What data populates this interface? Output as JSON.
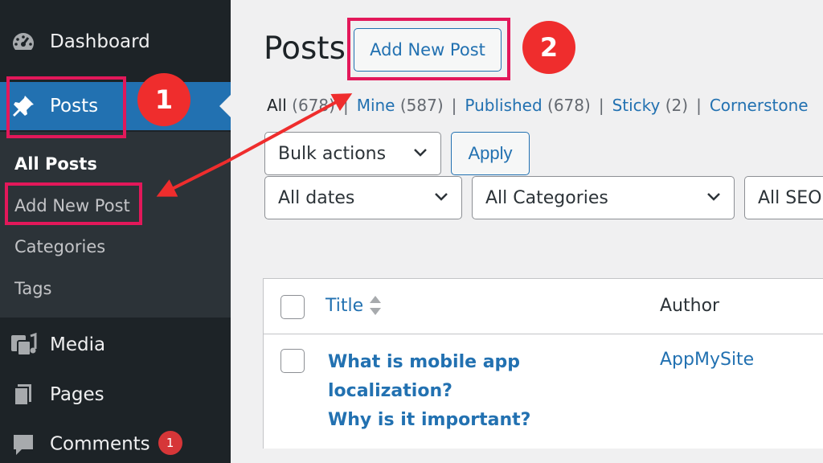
{
  "sidebar": {
    "items": [
      {
        "label": "Dashboard",
        "icon": "dashboard-icon"
      },
      {
        "label": "Posts",
        "icon": "pushpin-icon"
      },
      {
        "label": "Media",
        "icon": "media-icon"
      },
      {
        "label": "Pages",
        "icon": "pages-icon"
      },
      {
        "label": "Comments",
        "icon": "comment-icon",
        "badge": "1"
      }
    ],
    "submenu": [
      "All Posts",
      "Add New Post",
      "Categories",
      "Tags"
    ]
  },
  "main": {
    "title": "Posts",
    "add_new_label": "Add New Post",
    "filters": [
      {
        "label": "All",
        "count": "(678)"
      },
      {
        "label": "Mine",
        "count": "(587)"
      },
      {
        "label": "Published",
        "count": "(678)"
      },
      {
        "label": "Sticky",
        "count": "(2)"
      },
      {
        "label": "Cornerstone",
        "count": ""
      }
    ],
    "bulk_actions": "Bulk actions",
    "apply_label": "Apply",
    "date_filter": "All dates",
    "category_filter": "All Categories",
    "seo_filter": "All SEO",
    "table": {
      "col_title": "Title",
      "col_author": "Author",
      "rows": [
        {
          "title_line1": "What is mobile app localization?",
          "title_line2": "Why is it important?",
          "author": "AppMySite"
        }
      ]
    }
  },
  "annotations": {
    "step1": "1",
    "step2": "2"
  },
  "colors": {
    "sidebar_bg": "#1d2327",
    "accent": "#2271b1",
    "highlight": "#e3185a",
    "marker": "#ef2d2d"
  }
}
